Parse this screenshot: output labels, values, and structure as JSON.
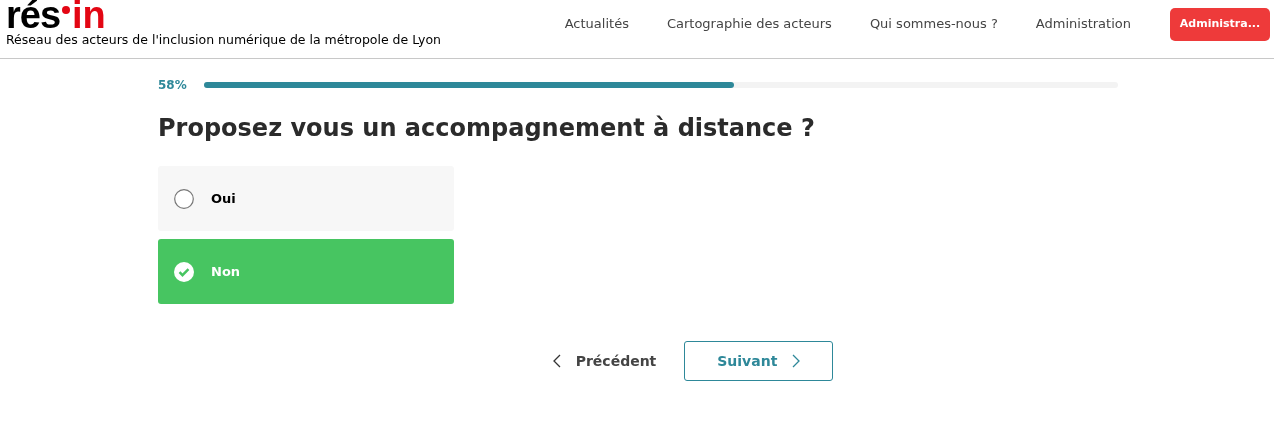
{
  "header": {
    "logo": {
      "part_1": "rés",
      "part_2": "in"
    },
    "tagline": "Réseau des acteurs de l'inclusion numérique de la métropole de Lyon",
    "nav": [
      {
        "label": "Actualités"
      },
      {
        "label": "Cartographie des acteurs"
      },
      {
        "label": "Qui sommes-nous ?"
      },
      {
        "label": "Administration"
      }
    ],
    "account_button": "Administra..."
  },
  "progress": {
    "label": "58%",
    "level": 0.58
  },
  "question": "Proposez vous un accompagnement à distance ?",
  "options": [
    {
      "label": "Oui",
      "selected": false
    },
    {
      "label": "Non",
      "selected": true
    }
  ],
  "navigation": {
    "previous": "Précédent",
    "next": "Suivant"
  }
}
